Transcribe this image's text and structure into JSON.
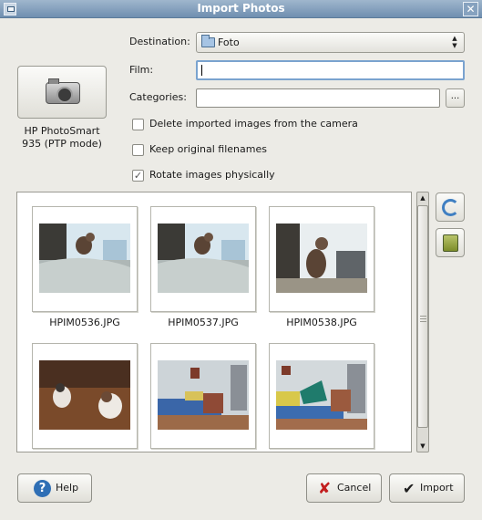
{
  "window": {
    "title": "Import Photos"
  },
  "camera": {
    "name_line1": "HP PhotoSmart",
    "name_line2": "935 (PTP mode)"
  },
  "form": {
    "destination": {
      "label": "Destination:",
      "value": "Foto"
    },
    "film": {
      "label": "Film:",
      "value": ""
    },
    "categories": {
      "label": "Categories:",
      "value": "",
      "browse_label": "..."
    }
  },
  "options": [
    {
      "label": "Delete imported images from the camera",
      "checked": false
    },
    {
      "label": "Keep original filenames",
      "checked": false
    },
    {
      "label": "Rotate images physically",
      "checked": true
    }
  ],
  "thumbnails": [
    {
      "filename": "HPIM0536.JPG",
      "scene": "cat-on-bed"
    },
    {
      "filename": "HPIM0537.JPG",
      "scene": "cat-on-bed"
    },
    {
      "filename": "HPIM0538.JPG",
      "scene": "cat-sitting"
    },
    {
      "filename": "",
      "scene": "two-cats-floor"
    },
    {
      "filename": "",
      "scene": "bedroom"
    },
    {
      "filename": "",
      "scene": "bedroom-2"
    }
  ],
  "buttons": {
    "help": "Help",
    "cancel": "Cancel",
    "import": "Import"
  },
  "icons": {
    "rotate": "rotate-icon",
    "trash": "trash-icon",
    "folder": "folder-icon",
    "camera": "camera-icon"
  }
}
